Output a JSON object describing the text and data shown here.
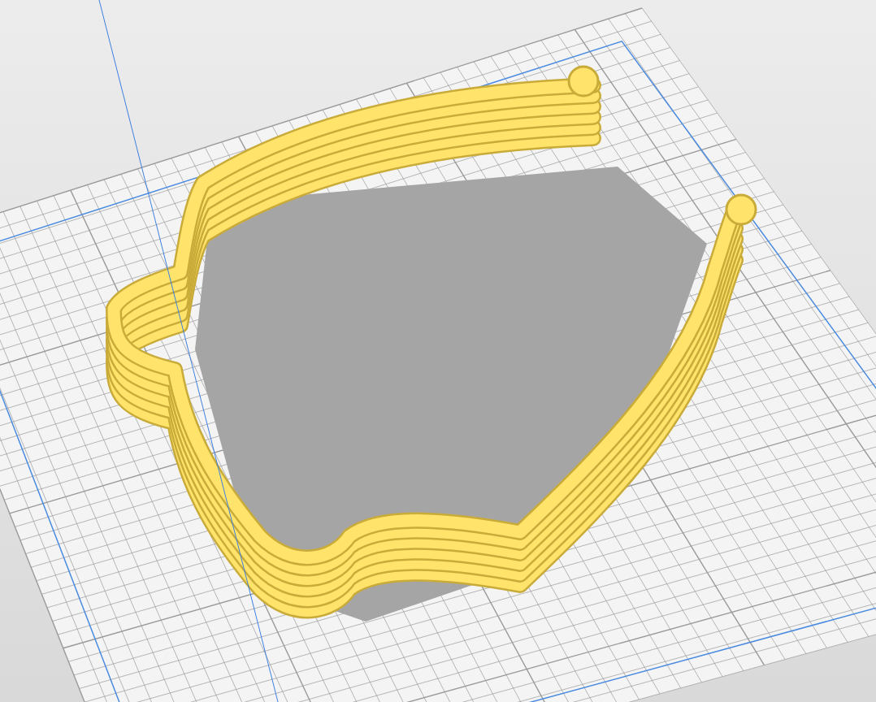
{
  "viewport": {
    "kind": "build-plate"
  }
}
